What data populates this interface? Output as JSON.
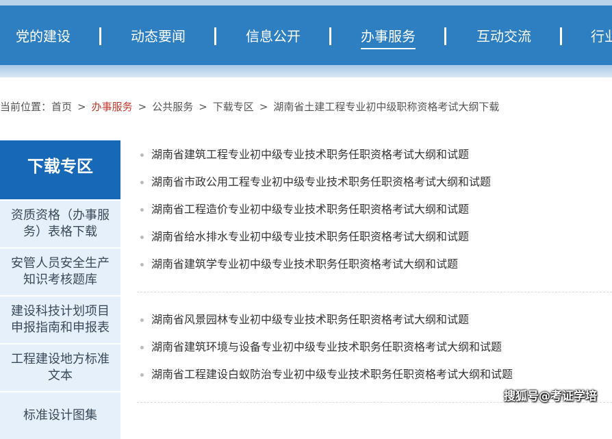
{
  "nav": {
    "items": [
      {
        "label": "党的建设"
      },
      {
        "label": "动态要闻"
      },
      {
        "label": "信息公开"
      },
      {
        "label": "办事服务"
      },
      {
        "label": "互动交流"
      },
      {
        "label": "行业"
      }
    ],
    "active_index": 3
  },
  "breadcrumb": {
    "prefix": "当前位置：",
    "items": [
      "首页",
      "办事服务",
      "公共服务",
      "下载专区",
      "湖南省土建工程专业初中级职称资格考试大纲下载"
    ],
    "separator": ">"
  },
  "sidebar": {
    "title": "下载专区",
    "items": [
      {
        "label": "资质资格（办事服务）表格下载"
      },
      {
        "label": "安管人员安全生产知识考核题库"
      },
      {
        "label": "建设科技计划项目申报指南和申报表"
      },
      {
        "label": "工程建设地方标准文本"
      },
      {
        "label": "标准设计图集"
      }
    ]
  },
  "list": {
    "group1": [
      "湖南省建筑工程专业初中级专业技术职务任职资格考试大纲和试题",
      "湖南省市政公用工程专业初中级专业技术职务任职资格考试大纲和试题",
      "湖南省工程造价专业初中级专业技术职务任职资格考试大纲和试题",
      "湖南省给水排水专业初中级专业技术职务任职资格考试大纲和试题",
      "湖南省建筑学专业初中级专业技术职务任职资格考试大纲和试题"
    ],
    "group2": [
      "湖南省风景园林专业初中级专业技术职务任职资格考试大纲和试题",
      "湖南省建筑环境与设备专业初中级专业技术职务任职资格考试大纲和试题",
      "湖南省工程建设白蚁防治专业初中级专业技术职务任职资格考试大纲和试题"
    ]
  },
  "watermark": "搜狐号@考证学培",
  "colors": {
    "nav_bg": "#2e7fc2",
    "sidebar_title_bg": "#1769b8",
    "sidebar_item_bg": "#e6f0fa",
    "breadcrumb_active": "#c0392b"
  }
}
